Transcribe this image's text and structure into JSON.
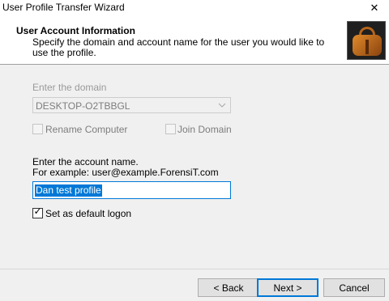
{
  "window": {
    "title": "User Profile Transfer Wizard",
    "close_glyph": "✕"
  },
  "header": {
    "title": "User Account  Information",
    "description": "Specify the domain and account name for the user you would like to use the profile.",
    "image_icon": "leather-bag-icon"
  },
  "domain": {
    "label": "Enter the domain",
    "selected_value": "DESKTOP-O2TBBGL",
    "enabled": false
  },
  "options": {
    "rename_computer": {
      "label": "Rename Computer",
      "checked": false,
      "enabled": false
    },
    "join_domain": {
      "label": "Join Domain",
      "checked": false,
      "enabled": false
    }
  },
  "account": {
    "label": "Enter the account name.",
    "example": "For example: user@example.ForensiT.com",
    "value": "Dan test profile"
  },
  "default_logon": {
    "label": "Set as default logon",
    "checked": true,
    "check_glyph": "✓"
  },
  "buttons": {
    "back": "< Back",
    "next": "Next >",
    "cancel": "Cancel"
  },
  "colors": {
    "accent": "#0078d7",
    "disabled_text": "#9a9a9a"
  }
}
